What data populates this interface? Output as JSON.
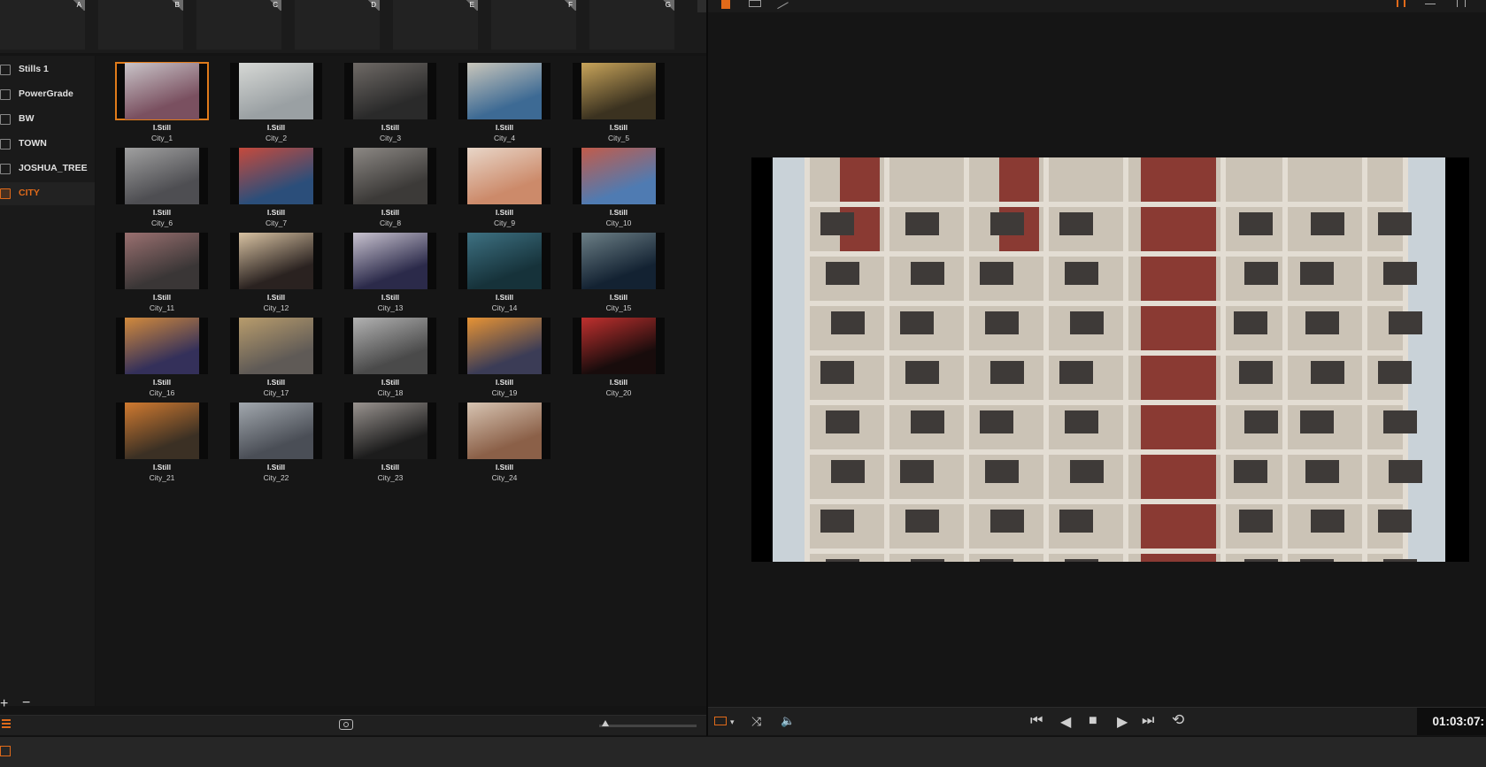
{
  "slots": [
    {
      "letter": "A"
    },
    {
      "letter": "B"
    },
    {
      "letter": "C"
    },
    {
      "letter": "D"
    },
    {
      "letter": "E"
    },
    {
      "letter": "F"
    },
    {
      "letter": "G"
    }
  ],
  "albums": [
    {
      "label": "Stills 1",
      "active": false
    },
    {
      "label": "PowerGrade",
      "active": false
    },
    {
      "label": "BW",
      "active": false
    },
    {
      "label": "TOWN",
      "active": false
    },
    {
      "label": "JOSHUA_TREE",
      "active": false
    },
    {
      "label": "CITY",
      "active": true
    }
  ],
  "album_controls": {
    "add": "+",
    "remove": "−"
  },
  "stills": [
    {
      "type": "I.Still",
      "name": "City_1"
    },
    {
      "type": "I.Still",
      "name": "City_2"
    },
    {
      "type": "I.Still",
      "name": "City_3"
    },
    {
      "type": "I.Still",
      "name": "City_4"
    },
    {
      "type": "I.Still",
      "name": "City_5"
    },
    {
      "type": "I.Still",
      "name": "City_6"
    },
    {
      "type": "I.Still",
      "name": "City_7"
    },
    {
      "type": "I.Still",
      "name": "City_8"
    },
    {
      "type": "I.Still",
      "name": "City_9"
    },
    {
      "type": "I.Still",
      "name": "City_10"
    },
    {
      "type": "I.Still",
      "name": "City_11"
    },
    {
      "type": "I.Still",
      "name": "City_12"
    },
    {
      "type": "I.Still",
      "name": "City_13"
    },
    {
      "type": "I.Still",
      "name": "City_14"
    },
    {
      "type": "I.Still",
      "name": "City_15"
    },
    {
      "type": "I.Still",
      "name": "City_16"
    },
    {
      "type": "I.Still",
      "name": "City_17"
    },
    {
      "type": "I.Still",
      "name": "City_18"
    },
    {
      "type": "I.Still",
      "name": "City_19"
    },
    {
      "type": "I.Still",
      "name": "City_20"
    },
    {
      "type": "I.Still",
      "name": "City_21"
    },
    {
      "type": "I.Still",
      "name": "City_22"
    },
    {
      "type": "I.Still",
      "name": "City_23"
    },
    {
      "type": "I.Still",
      "name": "City_24"
    }
  ],
  "selected_still": "City_1",
  "thumb_colors": [
    [
      "#7a5060",
      "#c9c4c8"
    ],
    [
      "#9aa0a3",
      "#d6d8d5"
    ],
    [
      "#2a2a2a",
      "#6f6a66"
    ],
    [
      "#3d6a94",
      "#c9c6bb"
    ],
    [
      "#3b3220",
      "#c8a45a"
    ],
    [
      "#4e4e52",
      "#a0a0a0"
    ],
    [
      "#2b4e7a",
      "#c64a3c"
    ],
    [
      "#3c3a38",
      "#8c8884"
    ],
    [
      "#cc8a6a",
      "#e8d6c8"
    ],
    [
      "#4f7bb2",
      "#c25b4a"
    ],
    [
      "#3a3636",
      "#9a7070"
    ],
    [
      "#2a2220",
      "#d8c2a2"
    ],
    [
      "#2b2a4a",
      "#c9c3d0"
    ],
    [
      "#16323a",
      "#3e7182"
    ],
    [
      "#132232",
      "#6c7f86"
    ],
    [
      "#34305a",
      "#d28a3c"
    ],
    [
      "#5f5a56",
      "#b89c6c"
    ],
    [
      "#4a4a4a",
      "#b2b2b2"
    ],
    [
      "#3b3c56",
      "#e79334"
    ],
    [
      "#180c0c",
      "#c0302e"
    ],
    [
      "#3b3024",
      "#d07a30"
    ],
    [
      "#4a4e56",
      "#a2a8ae"
    ],
    [
      "#1c1c1c",
      "#9a9490"
    ],
    [
      "#8b6048",
      "#d7c4b2"
    ]
  ],
  "viewer": {
    "palette": {
      "concrete": "#cbc3b6",
      "frame": "#e3ddd3",
      "brick": "#8a3a33",
      "sky": "#c9d2d8",
      "shadow": "#3e3a38"
    }
  },
  "timecode": "01:03:07:",
  "accent": "#e07b1a"
}
